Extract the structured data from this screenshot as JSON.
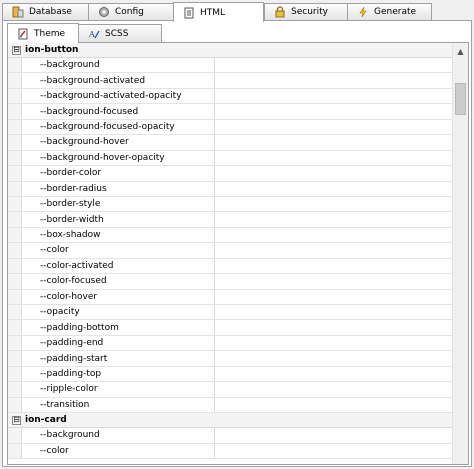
{
  "main_tabs": [
    {
      "label": "Database",
      "icon": "database-icon"
    },
    {
      "label": "Config",
      "icon": "gear-icon"
    },
    {
      "label": "HTML",
      "icon": "html-document-icon"
    },
    {
      "label": "Security",
      "icon": "lock-icon"
    },
    {
      "label": "Generate",
      "icon": "lightning-icon"
    }
  ],
  "active_main_tab": "HTML",
  "sub_tabs": [
    {
      "label": "Theme",
      "icon": "theme-icon"
    },
    {
      "label": "SCSS",
      "icon": "scss-icon"
    }
  ],
  "active_sub_tab": "Theme",
  "groups": [
    {
      "name": "ion-button",
      "toggle": "⊟",
      "properties": [
        "--background",
        "--background-activated",
        "--background-activated-opacity",
        "--background-focused",
        "--background-focused-opacity",
        "--background-hover",
        "--background-hover-opacity",
        "--border-color",
        "--border-radius",
        "--border-style",
        "--border-width",
        "--box-shadow",
        "--color",
        "--color-activated",
        "--color-focused",
        "--color-hover",
        "--opacity",
        "--padding-bottom",
        "--padding-end",
        "--padding-start",
        "--padding-top",
        "--ripple-color",
        "--transition"
      ]
    },
    {
      "name": "ion-card",
      "toggle": "⊟",
      "properties": [
        "--background",
        "--color"
      ]
    }
  ]
}
